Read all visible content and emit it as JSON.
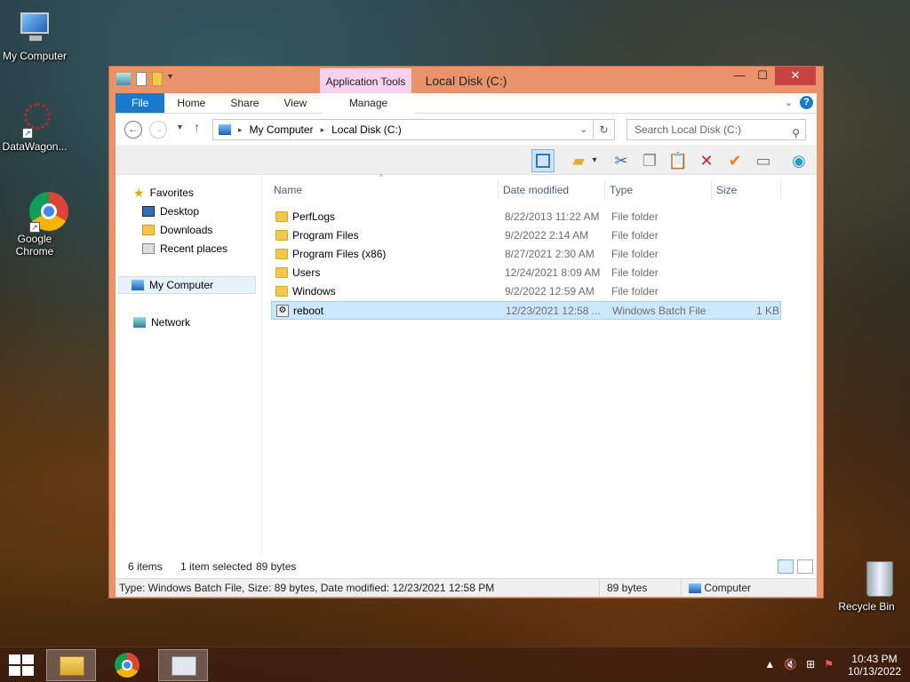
{
  "desktop": {
    "icons": [
      {
        "label": "My Computer"
      },
      {
        "label": "DataWagon..."
      },
      {
        "label": "Google Chrome"
      },
      {
        "label": "Recycle Bin"
      }
    ]
  },
  "window": {
    "title": "Local Disk (C:)",
    "contextual_tab": "Application Tools",
    "tabs": [
      "File",
      "Home",
      "Share",
      "View",
      "Manage"
    ],
    "address": {
      "crumbs": [
        "My Computer",
        "Local Disk (C:)"
      ]
    },
    "search": {
      "placeholder": "Search Local Disk (C:)"
    }
  },
  "navpane": {
    "favorites": "Favorites",
    "favorites_items": [
      "Desktop",
      "Downloads",
      "Recent places"
    ],
    "computer": "My Computer",
    "network": "Network"
  },
  "columns": [
    "Name",
    "Date modified",
    "Type",
    "Size"
  ],
  "files": [
    {
      "name": "PerfLogs",
      "date": "8/22/2013 11:22 AM",
      "type": "File folder",
      "size": "",
      "kind": "folder"
    },
    {
      "name": "Program Files",
      "date": "9/2/2022 2:14 AM",
      "type": "File folder",
      "size": "",
      "kind": "folder"
    },
    {
      "name": "Program Files (x86)",
      "date": "8/27/2021 2:30 AM",
      "type": "File folder",
      "size": "",
      "kind": "folder"
    },
    {
      "name": "Users",
      "date": "12/24/2021 8:09 AM",
      "type": "File folder",
      "size": "",
      "kind": "folder"
    },
    {
      "name": "Windows",
      "date": "9/2/2022 12:59 AM",
      "type": "File folder",
      "size": "",
      "kind": "folder"
    },
    {
      "name": "reboot",
      "date": "12/23/2021 12:58 ...",
      "type": "Windows Batch File",
      "size": "1 KB",
      "kind": "batch",
      "selected": true
    }
  ],
  "status": {
    "items": "6 items",
    "selected": "1 item selected",
    "size": "89 bytes"
  },
  "details": {
    "text": "Type: Windows Batch File, Size: 89 bytes, Date modified: 12/23/2021 12:58 PM",
    "size": "89 bytes",
    "location": "Computer"
  },
  "taskbar": {
    "time": "10:43 PM",
    "date": "10/13/2022"
  },
  "colors": {
    "titlebar": "#e9936a",
    "file_tab": "#1979ca",
    "selection": "#cce8ff",
    "close": "#c74343"
  }
}
